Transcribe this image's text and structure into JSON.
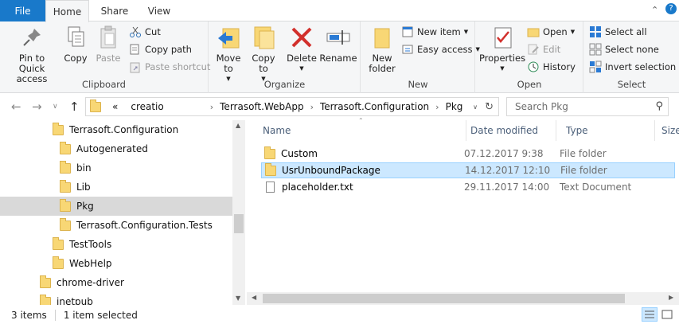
{
  "ribbon_tabs": {
    "file": "File",
    "home": "Home",
    "share": "Share",
    "view": "View"
  },
  "ribbon": {
    "clipboard": {
      "pin": "Pin to Quick access",
      "copy": "Copy",
      "paste": "Paste",
      "cut": "Cut",
      "copy_path": "Copy path",
      "paste_shortcut": "Paste shortcut",
      "label": "Clipboard"
    },
    "organize": {
      "move_to": "Move to",
      "copy_to": "Copy to",
      "delete": "Delete",
      "rename": "Rename",
      "label": "Organize"
    },
    "new": {
      "new_folder": "New folder",
      "new_item": "New item",
      "easy_access": "Easy access",
      "label": "New"
    },
    "open": {
      "properties": "Properties",
      "open": "Open",
      "edit": "Edit",
      "history": "History",
      "label": "Open"
    },
    "select": {
      "select_all": "Select all",
      "select_none": "Select none",
      "invert": "Invert selection",
      "label": "Select"
    }
  },
  "address": {
    "overflow": "«",
    "segments": [
      "creatio",
      "Terrasoft.WebApp",
      "Terrasoft.Configuration",
      "Pkg"
    ],
    "search_placeholder": "Search Pkg"
  },
  "tree": [
    {
      "label": "Terrasoft.Configuration",
      "selected": false
    },
    {
      "label": "Autogenerated",
      "selected": false
    },
    {
      "label": "bin",
      "selected": false
    },
    {
      "label": "Lib",
      "selected": false
    },
    {
      "label": "Pkg",
      "selected": true
    },
    {
      "label": "Terrasoft.Configuration.Tests",
      "selected": false
    },
    {
      "label": "TestTools",
      "selected": false
    },
    {
      "label": "WebHelp",
      "selected": false
    },
    {
      "label": "chrome-driver",
      "selected": false
    },
    {
      "label": "inetpub",
      "selected": false
    }
  ],
  "columns": {
    "name": "Name",
    "date": "Date modified",
    "type": "Type",
    "size": "Size"
  },
  "files": [
    {
      "name": "Custom",
      "date": "07.12.2017 9:38",
      "type": "File folder",
      "icon": "folder-icon",
      "selected": false
    },
    {
      "name": "UsrUnboundPackage",
      "date": "14.12.2017 12:10",
      "type": "File folder",
      "icon": "folder-icon",
      "selected": true
    },
    {
      "name": "placeholder.txt",
      "date": "29.11.2017 14:00",
      "type": "Text Document",
      "icon": "text-file-icon",
      "selected": false
    }
  ],
  "status": {
    "items": "3 items",
    "selected": "1 item selected"
  },
  "colors": {
    "accent": "#1979ca",
    "selection": "#cce8ff",
    "folder": "#f8d775"
  }
}
